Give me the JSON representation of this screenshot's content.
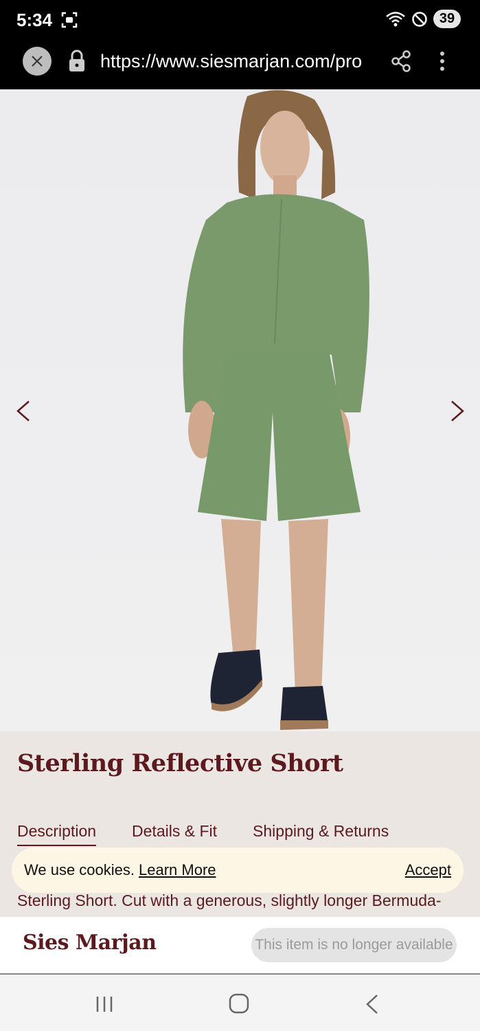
{
  "status_bar": {
    "time": "5:34",
    "battery": "39",
    "icons": [
      "screen-record-icon",
      "wifi-icon",
      "do-not-disturb-icon",
      "battery-icon"
    ]
  },
  "browser": {
    "url": "https://www.siesmarjan.com/pro",
    "icons": [
      "close-icon",
      "lock-icon",
      "share-icon",
      "more-vert-icon"
    ]
  },
  "product": {
    "title": "Sterling Reflective Short",
    "tabs": [
      {
        "label": "Description",
        "active": true
      },
      {
        "label": "Details & Fit",
        "active": false
      },
      {
        "label": "Shipping & Returns",
        "active": false
      }
    ],
    "description": "Sterling Short. Cut with a generous, slightly longer Bermuda-",
    "colors": {
      "shirt": "#7a9a6c",
      "shorts": "#7a9a6c",
      "brand": "#5c1a1f"
    }
  },
  "cookie": {
    "text": "We use cookies.",
    "learn_more": "Learn More",
    "accept": "Accept"
  },
  "bottom_bar": {
    "brand": "Sies Marjan",
    "status_button": "This item is no longer available"
  },
  "nav": {
    "icons": [
      "recent-apps-icon",
      "home-icon",
      "back-icon"
    ]
  }
}
